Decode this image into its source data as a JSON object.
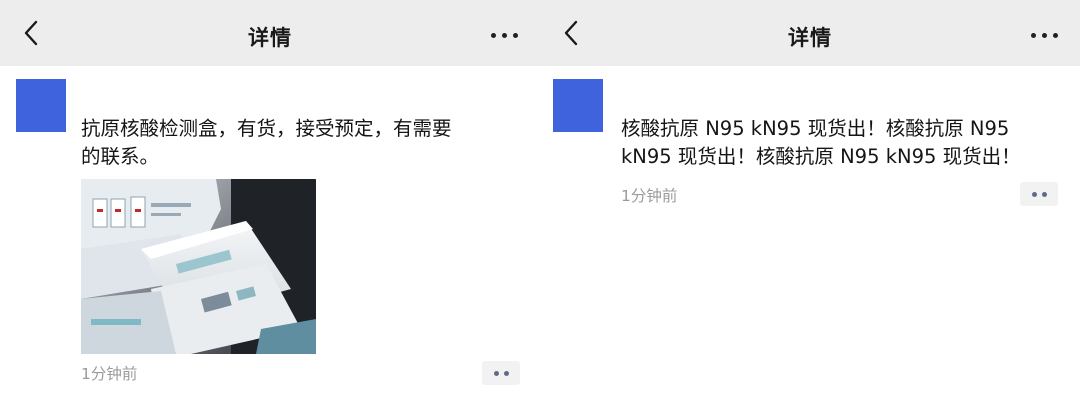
{
  "panels": [
    {
      "nav": {
        "back_icon": "chevron-left-icon",
        "title": "详情",
        "more_icon": "more-dots-icon"
      },
      "post": {
        "avatar_color": "#3f63dc",
        "text": "抗原核酸检测盒，有货，接受预定，有需要\n的联系。",
        "has_photo": true,
        "photo_icon": "test-kit-boxes-photo",
        "time": "1分钟前",
        "ops_icon": "comment-dots-icon"
      }
    },
    {
      "nav": {
        "back_icon": "chevron-left-icon",
        "title": "详情",
        "more_icon": "more-dots-icon"
      },
      "post": {
        "avatar_color": "#3f63dc",
        "text": "核酸抗原 N95 kN95 现货出！核酸抗原 N95\nkN95 现货出！核酸抗原 N95 kN95 现货出！",
        "has_photo": false,
        "time": "1分钟前",
        "ops_icon": "comment-dots-icon"
      }
    }
  ],
  "colors": {
    "navbar_bg": "#ededed",
    "time_text": "#9b9b9b",
    "ops_dot": "#5f6a8a"
  }
}
